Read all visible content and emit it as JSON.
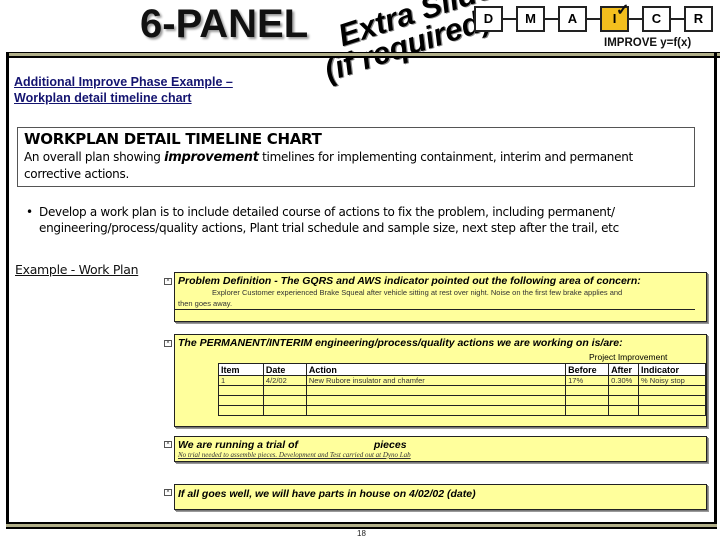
{
  "header": {
    "panel_title": "6-PANEL",
    "subtitle_line1": "Additional Improve Phase Example –",
    "subtitle_line2": "Workplan detail timeline chart",
    "watermark_line1": "Extra Slide",
    "watermark_line2": "(if required)"
  },
  "dmaic": {
    "steps": [
      {
        "label": "D",
        "active": false
      },
      {
        "label": "M",
        "active": false
      },
      {
        "label": "A",
        "active": false
      },
      {
        "label": "I",
        "active": true
      },
      {
        "label": "C",
        "active": false
      },
      {
        "label": "R",
        "active": false
      }
    ],
    "checkmark": "✓",
    "phase_label": "IMPROVE y=f(x)",
    "active_color": "#f3bf1e"
  },
  "definition": {
    "heading": "WORKPLAN DETAIL TIMELINE CHART",
    "text_before": "An overall plan showing ",
    "text_emphasis": "improvement",
    "text_after": " timelines for implementing containment, interim and permanent corrective actions."
  },
  "bullet": {
    "symbol": "•",
    "text": "Develop a work plan is to include detailed course of actions to fix the problem, including permanent/ engineering/process/quality actions, Plant trial schedule and sample size, next step after the trail, etc"
  },
  "example_link": "Example - Work Plan",
  "workplan": {
    "checkbox_glyph": "☒",
    "box_color": "#ffff9c",
    "problem": {
      "heading": "Problem Definition - The GQRS and AWS  indicator pointed out the following area of concern:",
      "text": "Explorer Customer experienced Brake Squeal after vehicle sitting at rest over night. Noise on the first few brake applies and then goes away."
    },
    "actions": {
      "heading": "The PERMANENT/INTERIM engineering/process/quality actions we are working on is/are:",
      "group_header": "Project Improvement",
      "columns": [
        "Item",
        "Date",
        "Action",
        "Before",
        "After",
        "Indicator"
      ],
      "rows": [
        [
          "1",
          "4/2/02",
          "New Rubore insulator and chamfer",
          "17%",
          "0.30%",
          "% Noisy stop"
        ],
        [
          "",
          "",
          "",
          "",
          "",
          ""
        ],
        [
          "",
          "",
          "",
          "",
          "",
          ""
        ],
        [
          "",
          "",
          "",
          "",
          "",
          ""
        ]
      ]
    },
    "trial": {
      "heading": "We are running a trial of                          pieces",
      "text": "No trial needed to assemble pieces. Development and Test carried out at Dyno Lab"
    },
    "parts": {
      "heading": "If all goes well, we will have parts in house on  4/02/02 (date)"
    }
  },
  "footer": {
    "page_number": "18"
  }
}
